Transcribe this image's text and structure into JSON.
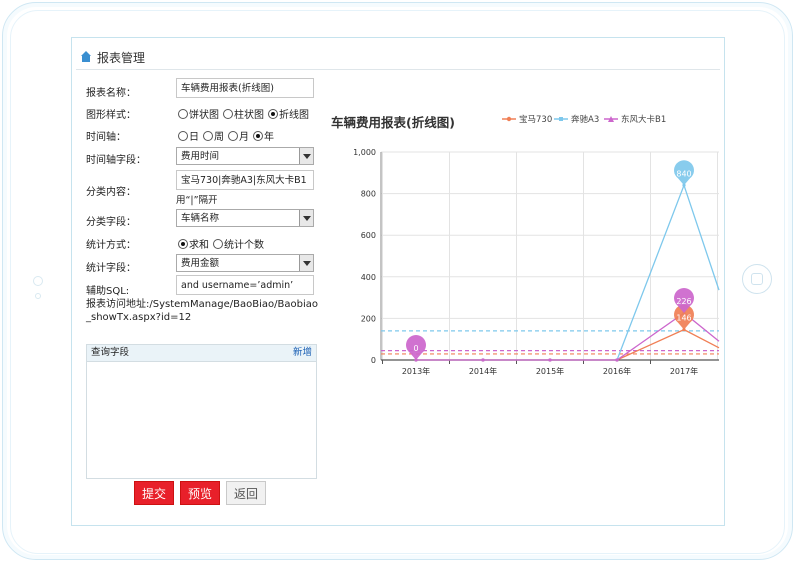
{
  "panel": {
    "title": "报表管理"
  },
  "form": {
    "report_name": {
      "label": "报表名称：",
      "value": "车辆费用报表(折线图)"
    },
    "chart_style": {
      "label": "图形样式：",
      "options": [
        "饼状图",
        "柱状图",
        "折线图"
      ],
      "selected": "折线图"
    },
    "time_axis": {
      "label": "时间轴：",
      "options": [
        "日",
        "周",
        "月",
        "年"
      ],
      "selected": "年"
    },
    "time_field": {
      "label": "时间轴字段：",
      "value": "费用时间"
    },
    "category_content": {
      "label": "分类内容：",
      "value": "宝马730|奔驰A3|东风大卡B1",
      "hint": "用“|”隔开"
    },
    "category_field": {
      "label": "分类字段：",
      "value": "车辆名称"
    },
    "stat_method": {
      "label": "统计方式：",
      "options": [
        "求和",
        "统计个数"
      ],
      "selected": "求和"
    },
    "stat_field": {
      "label": "统计字段：",
      "value": "费用金额"
    },
    "aux_sql": {
      "label": "辅助SQL:",
      "value": "and username=’admin’"
    },
    "report_url": {
      "label": "报表访问地址:",
      "value": "/SystemManage/BaoBiao/Baobiao_showTx.aspx?id=12"
    }
  },
  "query": {
    "header": "查询字段",
    "add": "新增"
  },
  "buttons": {
    "submit": "提交",
    "preview": "预览",
    "back": "返回"
  },
  "chart_data": {
    "type": "line",
    "title": "车辆费用报表(折线图)",
    "categories": [
      "2013年",
      "2014年",
      "2015年",
      "2016年",
      "2017年"
    ],
    "y_ticks": [
      "0",
      "200",
      "400",
      "600",
      "800",
      "1,000"
    ],
    "ylim": [
      0,
      1000
    ],
    "legend_position": "top-right",
    "series": [
      {
        "name": "宝马730",
        "color": "#f07f55",
        "values": [
          0,
          0,
          0,
          0,
          146
        ],
        "max_label": "146",
        "avg": 29.2
      },
      {
        "name": "奔驰A3",
        "color": "#7ec8ec",
        "values": [
          0,
          0,
          0,
          0,
          840
        ],
        "max_label": "840",
        "avg": 140
      },
      {
        "name": "东风大卡B1",
        "color": "#cc66cc",
        "values": [
          0,
          0,
          0,
          0,
          226
        ],
        "max_label": "226",
        "min_label": "0",
        "avg": 45.2
      }
    ]
  }
}
